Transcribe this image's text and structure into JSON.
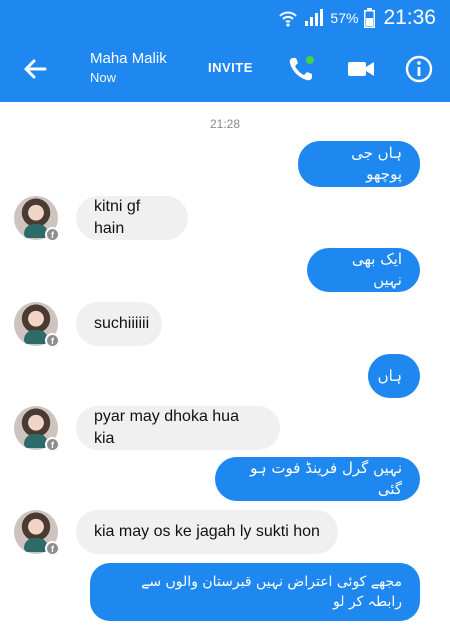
{
  "status_bar": {
    "battery": "57%",
    "time": "21:36"
  },
  "header": {
    "contact_name": "Maha Malik",
    "contact_status": "Now",
    "invite_label": "INVITE"
  },
  "chat": {
    "timestamp": "21:28",
    "messages": [
      {
        "direction": "out",
        "text": "ہاں جی پوچھو"
      },
      {
        "direction": "in",
        "text": "kitni gf hain"
      },
      {
        "direction": "out",
        "text": "ایک بھی نہیں"
      },
      {
        "direction": "in",
        "text": "suchiiiiii"
      },
      {
        "direction": "out",
        "text": "ہاں"
      },
      {
        "direction": "in",
        "text": "pyar may dhoka hua kia"
      },
      {
        "direction": "out",
        "text": "نہیں  گرل فرینڈ فوت ہو گئی"
      },
      {
        "direction": "in",
        "text": "kia may os ke jagah ly sukti hon"
      },
      {
        "direction": "out",
        "text": "مجھے کوئی اعتراض نہیں قبرستان والوں سے رابطہ کر لو"
      }
    ]
  },
  "colors": {
    "brand_blue": "#1e88f0",
    "incoming_bubble": "#f0f0f0",
    "online_dot": "#44d14a"
  },
  "icons": {
    "back": "arrow-left-icon",
    "call": "phone-icon",
    "video": "video-camera-icon",
    "info": "info-icon",
    "badge": "facebook-icon"
  }
}
